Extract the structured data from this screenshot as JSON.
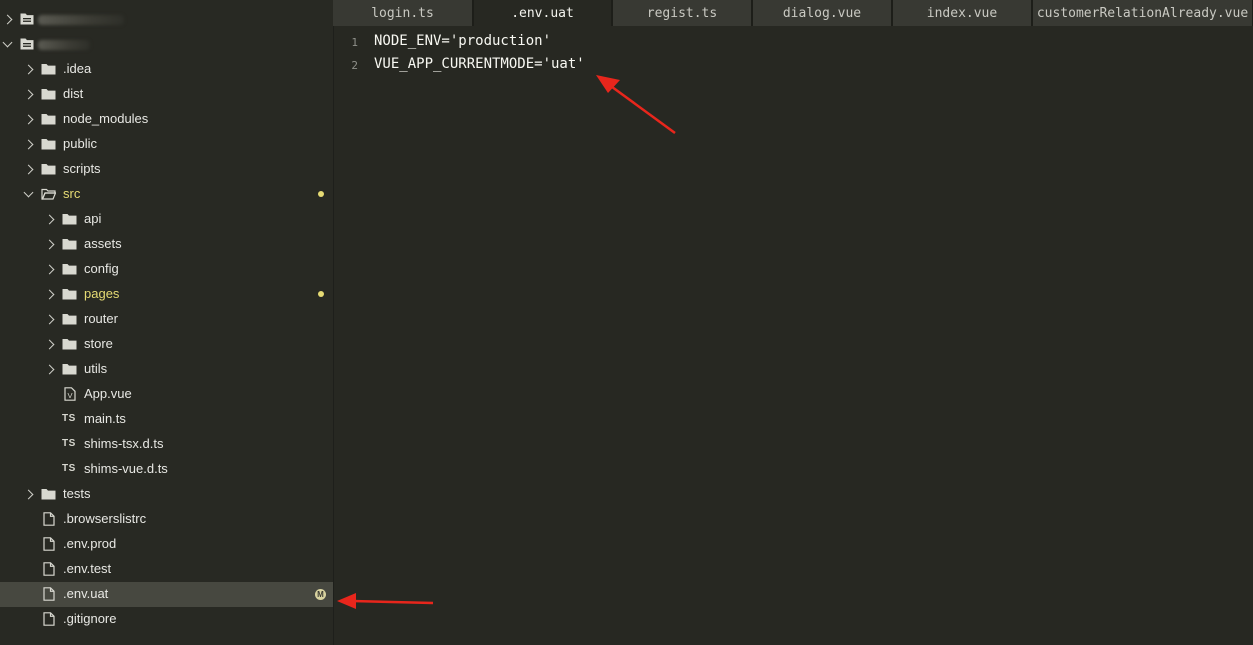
{
  "sidebar": {
    "rows": [
      {
        "label": "",
        "kind": "project",
        "depth": 0,
        "open": false
      },
      {
        "label": "",
        "kind": "project",
        "depth": 0,
        "open": true
      },
      {
        "label": ".idea",
        "kind": "folder",
        "depth": 1,
        "open": false
      },
      {
        "label": "dist",
        "kind": "folder",
        "depth": 1,
        "open": false
      },
      {
        "label": "node_modules",
        "kind": "folder",
        "depth": 1,
        "open": false
      },
      {
        "label": "public",
        "kind": "folder",
        "depth": 1,
        "open": false
      },
      {
        "label": "scripts",
        "kind": "folder",
        "depth": 1,
        "open": false
      },
      {
        "label": "src",
        "kind": "folder",
        "depth": 1,
        "open": true,
        "modified": true
      },
      {
        "label": "api",
        "kind": "folder",
        "depth": 2,
        "open": false
      },
      {
        "label": "assets",
        "kind": "folder",
        "depth": 2,
        "open": false
      },
      {
        "label": "config",
        "kind": "folder",
        "depth": 2,
        "open": false
      },
      {
        "label": "pages",
        "kind": "folder",
        "depth": 2,
        "open": false,
        "modified": true
      },
      {
        "label": "router",
        "kind": "folder",
        "depth": 2,
        "open": false
      },
      {
        "label": "store",
        "kind": "folder",
        "depth": 2,
        "open": false
      },
      {
        "label": "utils",
        "kind": "folder",
        "depth": 2,
        "open": false
      },
      {
        "label": "App.vue",
        "kind": "vue",
        "depth": 2,
        "icon_text": "V"
      },
      {
        "label": "main.ts",
        "kind": "ts",
        "depth": 2,
        "icon_text": "TS"
      },
      {
        "label": "shims-tsx.d.ts",
        "kind": "ts",
        "depth": 2,
        "icon_text": "TS"
      },
      {
        "label": "shims-vue.d.ts",
        "kind": "ts",
        "depth": 2,
        "icon_text": "TS"
      },
      {
        "label": "tests",
        "kind": "folder",
        "depth": 1,
        "open": false
      },
      {
        "label": ".browserslistrc",
        "kind": "file",
        "depth": 1
      },
      {
        "label": ".env.prod",
        "kind": "file",
        "depth": 1
      },
      {
        "label": ".env.test",
        "kind": "file",
        "depth": 1
      },
      {
        "label": ".env.uat",
        "kind": "file",
        "depth": 1,
        "selected": true,
        "badge": "M"
      },
      {
        "label": ".gitignore",
        "kind": "file",
        "depth": 1
      }
    ]
  },
  "tabs": [
    {
      "label": "login.ts",
      "active": false
    },
    {
      "label": ".env.uat",
      "active": true
    },
    {
      "label": "regist.ts",
      "active": false
    },
    {
      "label": "dialog.vue",
      "active": false
    },
    {
      "label": "index.vue",
      "active": false
    },
    {
      "label": "customerRelationAlready.vue",
      "active": false
    }
  ],
  "editor": {
    "lines": [
      {
        "number": "1",
        "text": "NODE_ENV='production'"
      },
      {
        "number": "2",
        "text": "VUE_APP_CURRENTMODE='uat'"
      }
    ]
  },
  "colors": {
    "background": "#272822",
    "sidebar": "#282923",
    "selected_row": "#474840",
    "modified": "#e6db74",
    "annotation_arrow": "#e8261c"
  },
  "icons": {
    "folder": "folder-icon",
    "file": "file-icon",
    "ts": "typescript-icon",
    "vue": "vue-file-icon",
    "chevron_right": "chevron-right-icon",
    "chevron_down": "chevron-down-icon"
  }
}
